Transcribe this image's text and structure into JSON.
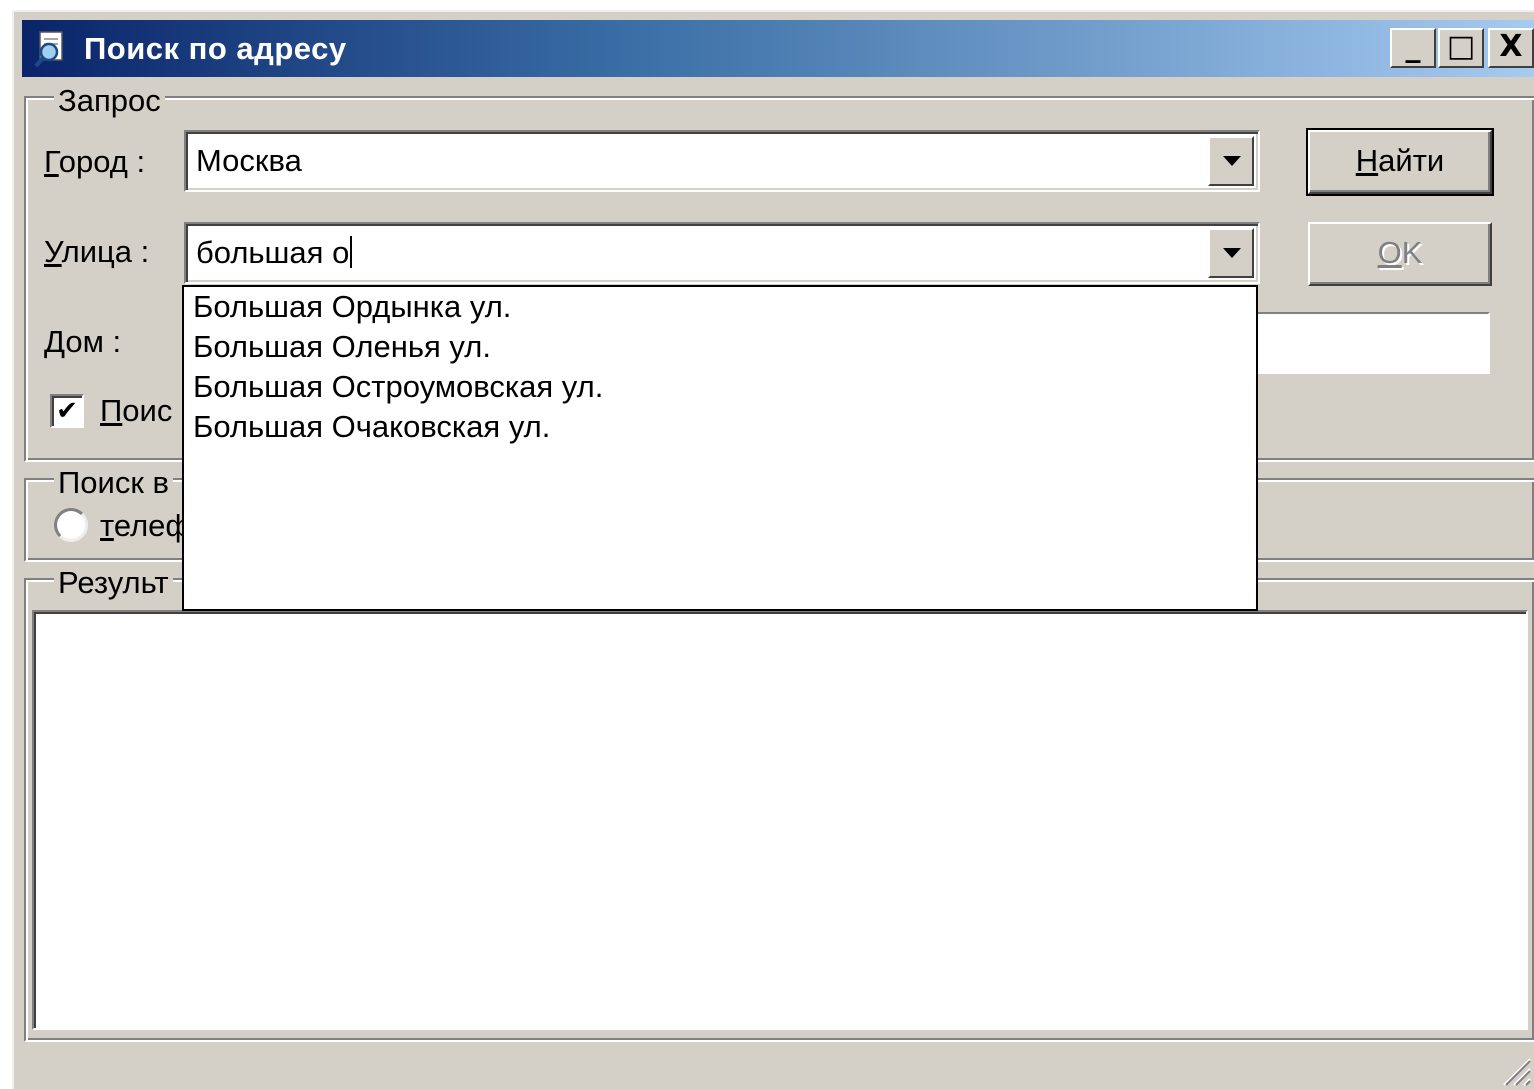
{
  "window": {
    "title": "Поиск по адресу",
    "controls": {
      "minimize": "_",
      "maximize": "□",
      "close": "X"
    }
  },
  "query": {
    "legend": "Запрос",
    "city": {
      "label_hot": "Г",
      "label_rest": "ород :",
      "value": "Москва"
    },
    "street": {
      "label_hot": "У",
      "label_rest": "лица :",
      "value": "большая о"
    },
    "house": {
      "label_hot": "Д",
      "label_rest": "ом :",
      "value": ""
    },
    "checkbox": {
      "checked": true,
      "label_hot": "П",
      "label_rest": "оис"
    },
    "find_button": {
      "hot": "Н",
      "rest": "айти"
    },
    "ok_button": {
      "hot": "O",
      "rest": "K",
      "enabled": false
    }
  },
  "search_in": {
    "legend": "Поиск в",
    "radio": {
      "selected": false,
      "label_hot": "т",
      "label_rest": "елеф"
    }
  },
  "results": {
    "legend": "Результ"
  },
  "street_suggestions": [
    "Большая Ордынка ул.",
    "Большая Оленья ул.",
    "Большая Остроумовская ул.",
    "Большая Очаковская ул."
  ],
  "colors": {
    "title_gradient_start": "#0a246a",
    "title_gradient_end": "#a6caf0",
    "face": "#d4d0c8"
  }
}
